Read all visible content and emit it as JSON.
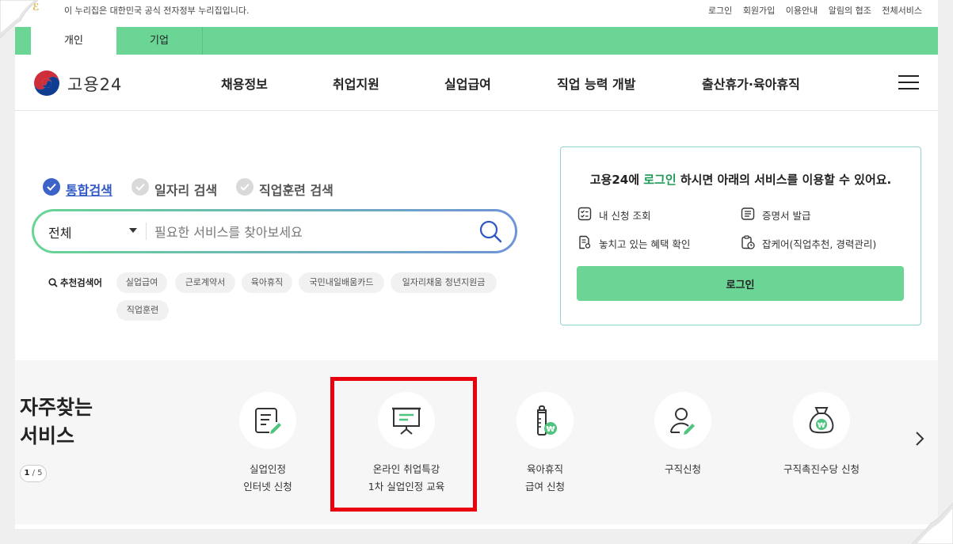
{
  "topbar": {
    "notice": "이 누리집은 대한민국 공식 전자정부 누리집입니다.",
    "links": [
      "로그인",
      "회원가입",
      "이용안내",
      "알림의 협조",
      "전체서비스"
    ]
  },
  "tabs": [
    {
      "label": "개인"
    },
    {
      "label": "기업"
    }
  ],
  "brand": {
    "name": "고용24"
  },
  "nav": [
    {
      "label": "채용정보"
    },
    {
      "label": "취업지원"
    },
    {
      "label": "실업급여"
    },
    {
      "label": "직업 능력 개발"
    },
    {
      "label": "출산휴가·육아휴직"
    }
  ],
  "search": {
    "tabs": [
      {
        "label": "통합검색",
        "checked": true
      },
      {
        "label": "일자리 검색",
        "checked": false
      },
      {
        "label": "직업훈련 검색",
        "checked": false
      }
    ],
    "category": "전체",
    "placeholder": "필요한 서비스를 찾아보세요",
    "recommend_label": "추천검색어",
    "keywords": [
      "실업급여",
      "근로계약서",
      "육아휴직",
      "국민내일배움카드",
      "일자리채움 청년지원금",
      "직업훈련"
    ]
  },
  "login_card": {
    "msg_pre": "고용24에 ",
    "msg_highlight": "로그인",
    "msg_post": " 하시면 아래의 서비스를 이용할 수 있어요.",
    "services": [
      {
        "label": "내 신청 조회",
        "icon": "checklist-icon"
      },
      {
        "label": "증명서 발급",
        "icon": "certificate-icon"
      },
      {
        "label": "놓치고 있는 혜택 확인",
        "icon": "document-search-icon"
      },
      {
        "label": "잡케어(직업추천, 경력관리)",
        "icon": "clipboard-clock-icon"
      }
    ],
    "button": "로그인"
  },
  "favorites": {
    "title_line1": "자주찾는",
    "title_line2": "서비스",
    "pager_current": "1",
    "pager_total": "/ 5",
    "items": [
      {
        "line1": "실업인정",
        "line2": "인터넷 신청",
        "icon": "document-edit-icon"
      },
      {
        "line1": "온라인 취업특강",
        "line2": "1차 실업인정 교육",
        "icon": "presentation-board-icon"
      },
      {
        "line1": "육아휴직",
        "line2": "급여 신청",
        "icon": "baby-bottle-won-icon"
      },
      {
        "line1": "구직신청",
        "line2": "",
        "icon": "person-edit-icon"
      },
      {
        "line1": "구직촉진수당 신청",
        "line2": "",
        "icon": "money-bag-won-icon"
      }
    ]
  },
  "colors": {
    "accent_green": "#6ad595",
    "brand_blue": "#3c63c8",
    "highlight_red": "#e8000d"
  }
}
